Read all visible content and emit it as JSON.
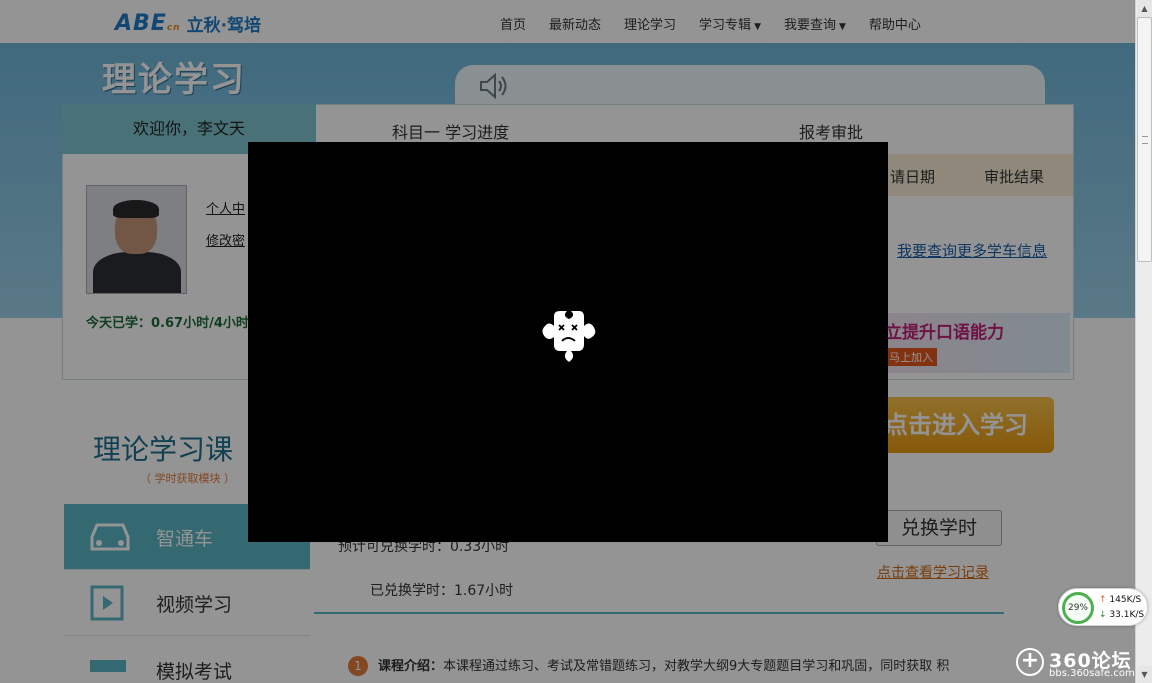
{
  "logo": {
    "mark": "ABE",
    "mark_suffix": "cn",
    "name": "立秋·驾培"
  },
  "nav": [
    {
      "label": "首页",
      "has_dropdown": false
    },
    {
      "label": "最新动态",
      "has_dropdown": false
    },
    {
      "label": "理论学习",
      "has_dropdown": false
    },
    {
      "label": "学习专辑",
      "has_dropdown": true
    },
    {
      "label": "我要查询",
      "has_dropdown": true
    },
    {
      "label": "帮助中心",
      "has_dropdown": false
    }
  ],
  "banner": {
    "title": "理论学习",
    "speaker_icon": "speaker-icon"
  },
  "panel": {
    "welcome": "欢迎你，李文天",
    "progress_label": "科目一  学习进度",
    "approve_label": "报考审批",
    "apply_date_col": "请日期",
    "approve_result_col": "审批结果",
    "more_link": "我要查询更多学车信息",
    "profile_link1": "个人中",
    "profile_link2": "修改密",
    "study_today": "今天已学：0.67小时/4小时"
  },
  "ad": {
    "line1": "立提升口语能力",
    "line2": "马上加入"
  },
  "enter_button": "点击进入学习",
  "course": {
    "title": "理论学习课",
    "subtitle": "（ 学时获取模块 ）"
  },
  "side_menu": [
    {
      "label": "智通车",
      "icon": "car-icon",
      "active": true
    },
    {
      "label": "视频学习",
      "icon": "film-icon",
      "active": false
    },
    {
      "label": "模拟考试",
      "icon": "exam-icon",
      "active": false
    }
  ],
  "exchange": {
    "button": "兑换学时",
    "estimated": "预计可兑换学时：0.33小时",
    "exchanged": "已兑换学时：1.67小时",
    "record_link": "点击查看学习记录"
  },
  "intro": {
    "number": "1",
    "label": "课程介绍：",
    "text": "本课程通过练习、考试及常错题练习，对教学大纲9大专题题目学习和巩固，同时获取 积"
  },
  "plugin": {
    "icon": "crashed-plugin-icon"
  },
  "netwidget": {
    "percent": "29%",
    "up": "145K/S",
    "down": "33.1K/S",
    "up_arrow": "↑",
    "down_arrow": "↓"
  },
  "watermark": {
    "title": "360论坛",
    "url": "bbs.360safe.com"
  },
  "colors": {
    "banner": "#6fb6d9",
    "teal": "#5bb5c4",
    "orange": "#e89a12",
    "link": "#1a5fa8"
  }
}
